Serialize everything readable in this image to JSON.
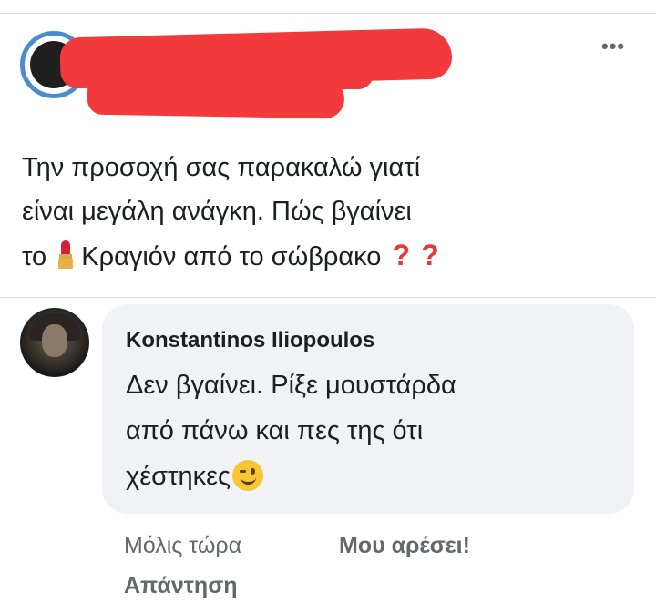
{
  "post": {
    "lines": [
      "Την προσοχή σας παρακαλώ γιατί",
      "είναι μεγάλη ανάγκη. Πώς βγαίνει"
    ],
    "line3_start": "το",
    "line3_end": "Κραγιόν από το σώβρακο",
    "question_marks": [
      "?",
      "?"
    ],
    "icons": {
      "inline": "lipstick-icon",
      "menu": "more-options-icon"
    },
    "more_glyph": "•••"
  },
  "comment": {
    "author": "Konstantinos Iliopoulos",
    "lines": [
      "Δεν βγαίνει. Ρίξε μουστάρδα",
      "από πάνω και πες της ότι",
      "χέστηκες"
    ],
    "emoji": "wink-icon",
    "time": "Μόλις τώρα",
    "like_label": "Μου αρέσει!",
    "reply_label": "Απάντηση"
  },
  "colors": {
    "redaction": "#f23a3c",
    "bubble": "#f0f2f5",
    "secondary_text": "#65676b",
    "question_mark": "#e53935"
  }
}
